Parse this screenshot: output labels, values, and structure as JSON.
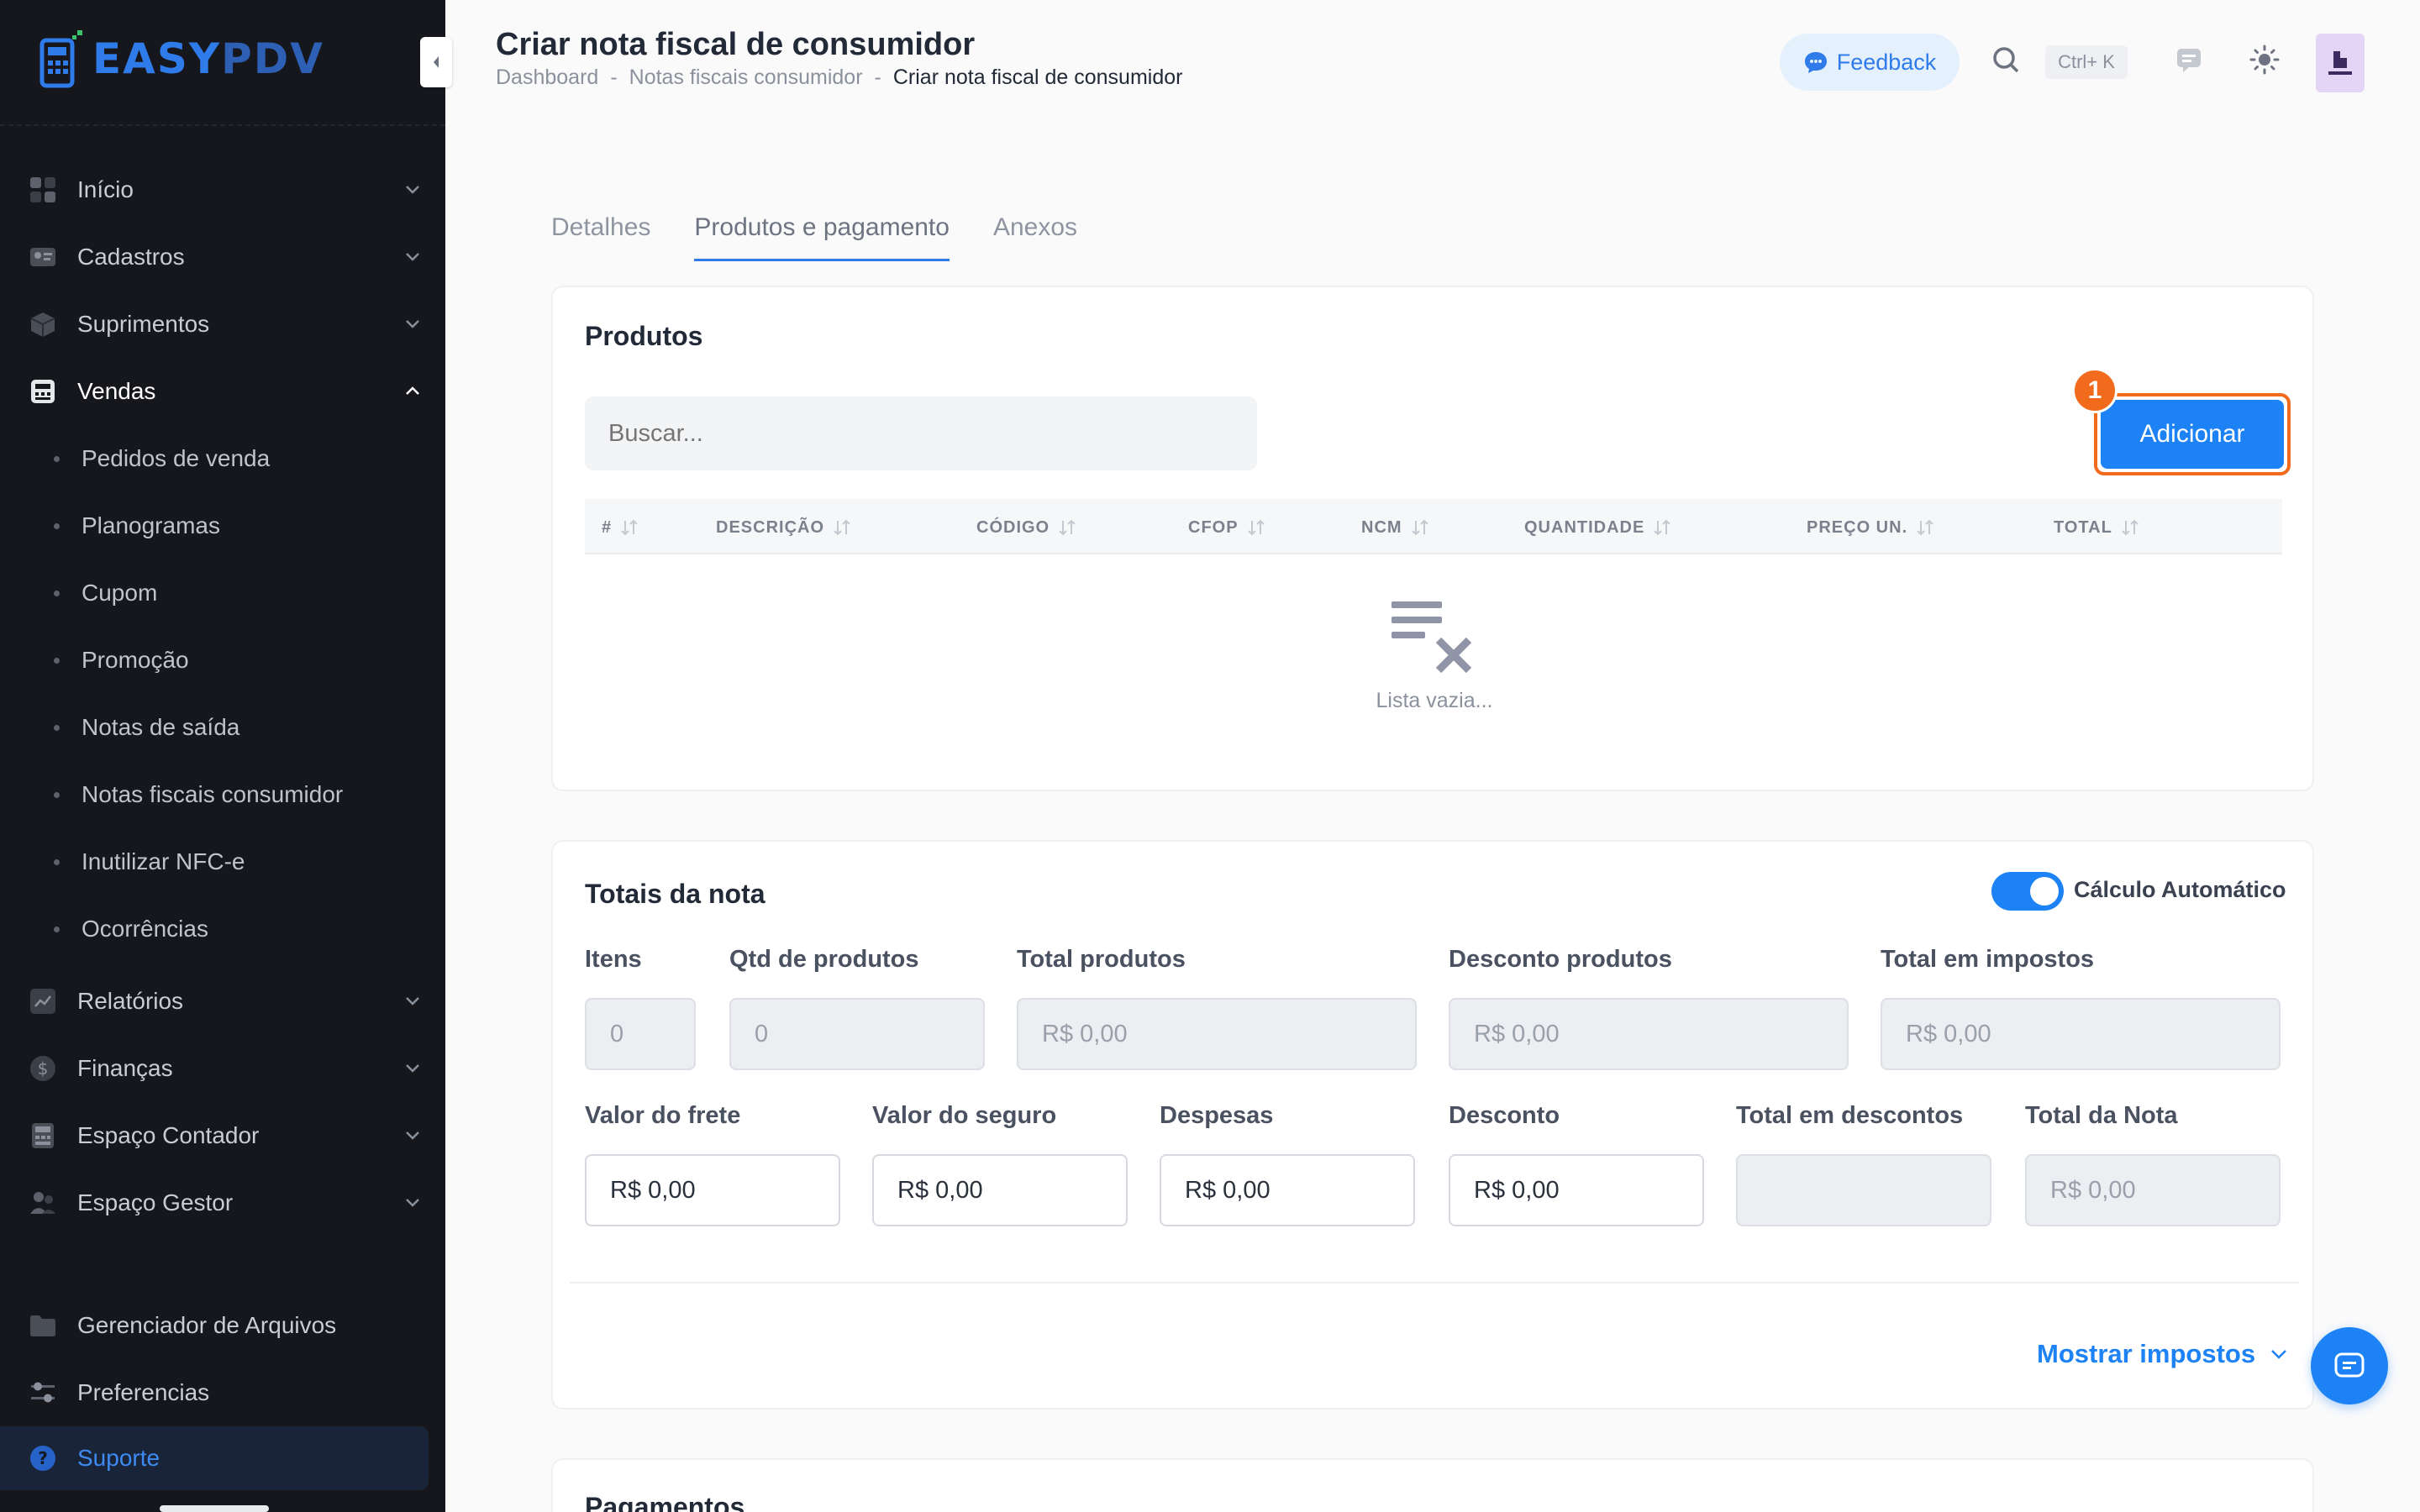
{
  "brand": {
    "logo_text_a": "EASY",
    "logo_text_b": "PDV"
  },
  "sidebar": {
    "items": [
      {
        "label": "Início",
        "icon": "grid-icon"
      },
      {
        "label": "Cadastros",
        "icon": "id-card-icon"
      },
      {
        "label": "Suprimentos",
        "icon": "box-icon"
      },
      {
        "label": "Vendas",
        "icon": "cash-register-icon"
      }
    ],
    "sales_sub": [
      "Pedidos de venda",
      "Planogramas",
      "Cupom",
      "Promoção",
      "Notas de saída",
      "Notas fiscais consumidor",
      "Inutilizar NFC-e",
      "Ocorrências"
    ],
    "items_after": [
      {
        "label": "Relatórios",
        "icon": "chart-icon"
      },
      {
        "label": "Finanças",
        "icon": "dollar-icon"
      },
      {
        "label": "Espaço Contador",
        "icon": "calculator-icon"
      },
      {
        "label": "Espaço Gestor",
        "icon": "users-icon"
      }
    ],
    "bottom": [
      {
        "label": "Gerenciador de Arquivos",
        "icon": "folder-icon"
      },
      {
        "label": "Preferencias",
        "icon": "sliders-icon"
      }
    ],
    "support": "Suporte"
  },
  "header": {
    "title": "Criar nota fiscal de consumidor",
    "breadcrumb": [
      "Dashboard",
      "Notas fiscais consumidor",
      "Criar nota fiscal de consumidor"
    ],
    "sep": "-",
    "feedback": "Feedback",
    "shortcut": "Ctrl+ K"
  },
  "tabs": [
    "Detalhes",
    "Produtos e pagamento",
    "Anexos"
  ],
  "produtos": {
    "title": "Produtos",
    "search_placeholder": "Buscar...",
    "add_label": "Adicionar",
    "badge": "1",
    "columns": [
      "#",
      "DESCRIÇÃO",
      "CÓDIGO",
      "CFOP",
      "NCM",
      "QUANTIDADE",
      "PREÇO UN.",
      "TOTAL"
    ],
    "empty": "Lista vazia..."
  },
  "totais": {
    "title": "Totais da nota",
    "auto_label": "Cálculo Automático",
    "auto_on": true,
    "row1": [
      {
        "label": "Itens",
        "value": "0"
      },
      {
        "label": "Qtd de produtos",
        "value": "0"
      },
      {
        "label": "Total produtos",
        "value": "R$ 0,00"
      },
      {
        "label": "Desconto produtos",
        "value": "R$ 0,00"
      },
      {
        "label": "Total em impostos",
        "value": "R$ 0,00"
      }
    ],
    "row2": [
      {
        "label": "Valor do frete",
        "value": "R$ 0,00"
      },
      {
        "label": "Valor do seguro",
        "value": "R$ 0,00"
      },
      {
        "label": "Despesas",
        "value": "R$ 0,00"
      },
      {
        "label": "Desconto",
        "value": "R$ 0,00"
      },
      {
        "label": "Total em descontos",
        "value": ""
      },
      {
        "label": "Total da Nota",
        "value": "R$ 0,00"
      }
    ],
    "show_taxes": "Mostrar impostos"
  },
  "pagamentos": {
    "title": "Pagamentos"
  },
  "colors": {
    "accent": "#1d82f5",
    "highlight": "#f26a1b",
    "sidebar_bg": "#15171c"
  }
}
